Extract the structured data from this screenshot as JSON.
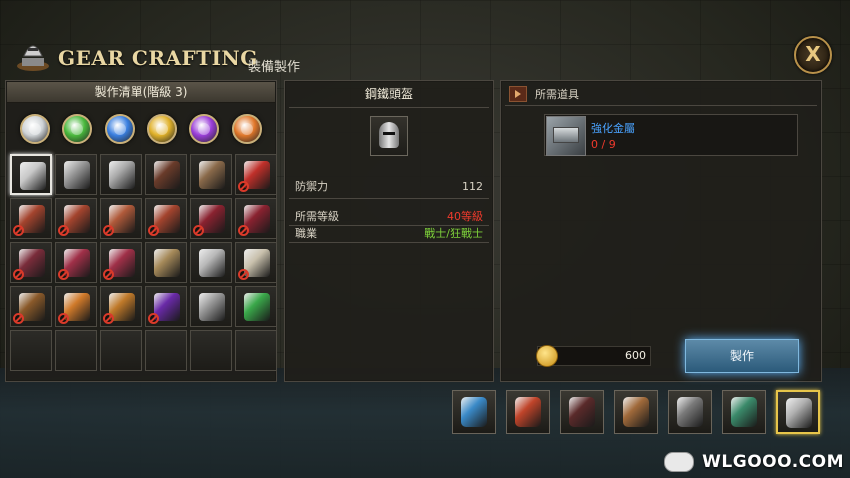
{
  "header": {
    "title": "GEAR CRAFTING",
    "subtitle": "裝備製作",
    "close_label": "X"
  },
  "craft_list": {
    "heading": "製作清單(階級 3)",
    "gems": [
      {
        "name": "silver-gem-icon",
        "color": "#cfd3d6"
      },
      {
        "name": "green-gem-icon",
        "color": "#49b83c"
      },
      {
        "name": "blue-gem-icon",
        "color": "#3a7fe0"
      },
      {
        "name": "yellow-gem-icon",
        "color": "#e0b12a"
      },
      {
        "name": "purple-gem-icon",
        "color": "#9a3ed8"
      },
      {
        "name": "orange-gem-icon",
        "color": "#e0772a"
      }
    ],
    "rows": [
      [
        {
          "name": "silver-helmet-icon",
          "color": "#c8c8c8",
          "locked": false,
          "selected": true
        },
        {
          "name": "silver-armor-icon",
          "color": "#9a9a9a",
          "locked": false
        },
        {
          "name": "silver-greaves-icon",
          "color": "#aaaaaa",
          "locked": false
        },
        {
          "name": "leather-gloves-icon",
          "color": "#6a3b2a",
          "locked": false
        },
        {
          "name": "leather-boots-icon",
          "color": "#8a6a4a",
          "locked": false
        },
        {
          "name": "red-wings-icon",
          "color": "#c0302a",
          "locked": true
        }
      ],
      [
        {
          "name": "red-armor-icon",
          "color": "#a4442e",
          "locked": true
        },
        {
          "name": "red-pants-icon",
          "color": "#a4442e",
          "locked": true
        },
        {
          "name": "red-bracers-icon",
          "color": "#b05a3a",
          "locked": true
        },
        {
          "name": "red-boots-icon",
          "color": "#a4442e",
          "locked": true
        },
        {
          "name": "red-hood-icon",
          "color": "#8a2230",
          "locked": true
        },
        {
          "name": "red-robe-icon",
          "color": "#8a2230",
          "locked": true
        }
      ],
      [
        {
          "name": "crimson-pants-icon",
          "color": "#7a2c3a",
          "locked": true
        },
        {
          "name": "crimson-gloves-icon",
          "color": "#a03048",
          "locked": true
        },
        {
          "name": "crimson-boots-icon",
          "color": "#a03048",
          "locked": true
        },
        {
          "name": "golden-belt-icon",
          "color": "#a68a5a",
          "locked": false
        },
        {
          "name": "sword-icon",
          "color": "#b8b8b8",
          "locked": false
        },
        {
          "name": "shield-icon",
          "color": "#c9c1ad",
          "locked": true
        }
      ],
      [
        {
          "name": "bow-icon",
          "color": "#8a5a2a",
          "locked": true
        },
        {
          "name": "carrot-staff-icon",
          "color": "#d07a2a",
          "locked": true
        },
        {
          "name": "blue-scepter-icon",
          "color": "#c07a2a",
          "locked": true
        },
        {
          "name": "purple-tome-icon",
          "color": "#6a2aa8",
          "locked": true
        },
        {
          "name": "silver-ring-icon",
          "color": "#9a9a9a",
          "locked": false
        },
        {
          "name": "green-amulet-icon",
          "color": "#3aa84a",
          "locked": false
        }
      ],
      [
        {
          "name": "empty-slot",
          "color": "",
          "locked": false
        },
        {
          "name": "empty-slot",
          "color": "",
          "locked": false
        },
        {
          "name": "empty-slot",
          "color": "",
          "locked": false
        },
        {
          "name": "empty-slot",
          "color": "",
          "locked": false
        },
        {
          "name": "empty-slot",
          "color": "",
          "locked": false
        },
        {
          "name": "empty-slot",
          "color": "",
          "locked": false
        }
      ]
    ]
  },
  "item_detail": {
    "name": "鋼鐵頭盔",
    "icon": "steel-helmet-icon",
    "stat_label": "防禦力",
    "stat_value": "112",
    "req_level_label": "所需等級",
    "req_level_value": "40等級",
    "class_label": "職業",
    "class_value": "戰士/狂戰士"
  },
  "required_items": {
    "heading": "所需道具",
    "material_name": "強化金屬",
    "material_icon": "metal-ingot-icon",
    "material_count": "0 / 9",
    "gold_cost": "600",
    "craft_button": "製作"
  },
  "bottom_tabs": [
    {
      "name": "blue-cape-tab-icon",
      "color": "#3a8ac8",
      "selected": false
    },
    {
      "name": "red-cape-tab-icon",
      "color": "#c0442a",
      "selected": false
    },
    {
      "name": "dark-armor-tab-icon",
      "color": "#5a2a2a",
      "selected": false
    },
    {
      "name": "bronze-armor-tab-icon",
      "color": "#a06a3a",
      "selected": false
    },
    {
      "name": "steel-armor-tab-icon",
      "color": "#7a7a7a",
      "selected": false
    },
    {
      "name": "jade-armor-tab-icon",
      "color": "#3a8a6a",
      "selected": false
    },
    {
      "name": "silver-armor-tab-icon",
      "color": "#b0b0b0",
      "selected": true
    }
  ],
  "watermark": "WLGOOO.COM"
}
